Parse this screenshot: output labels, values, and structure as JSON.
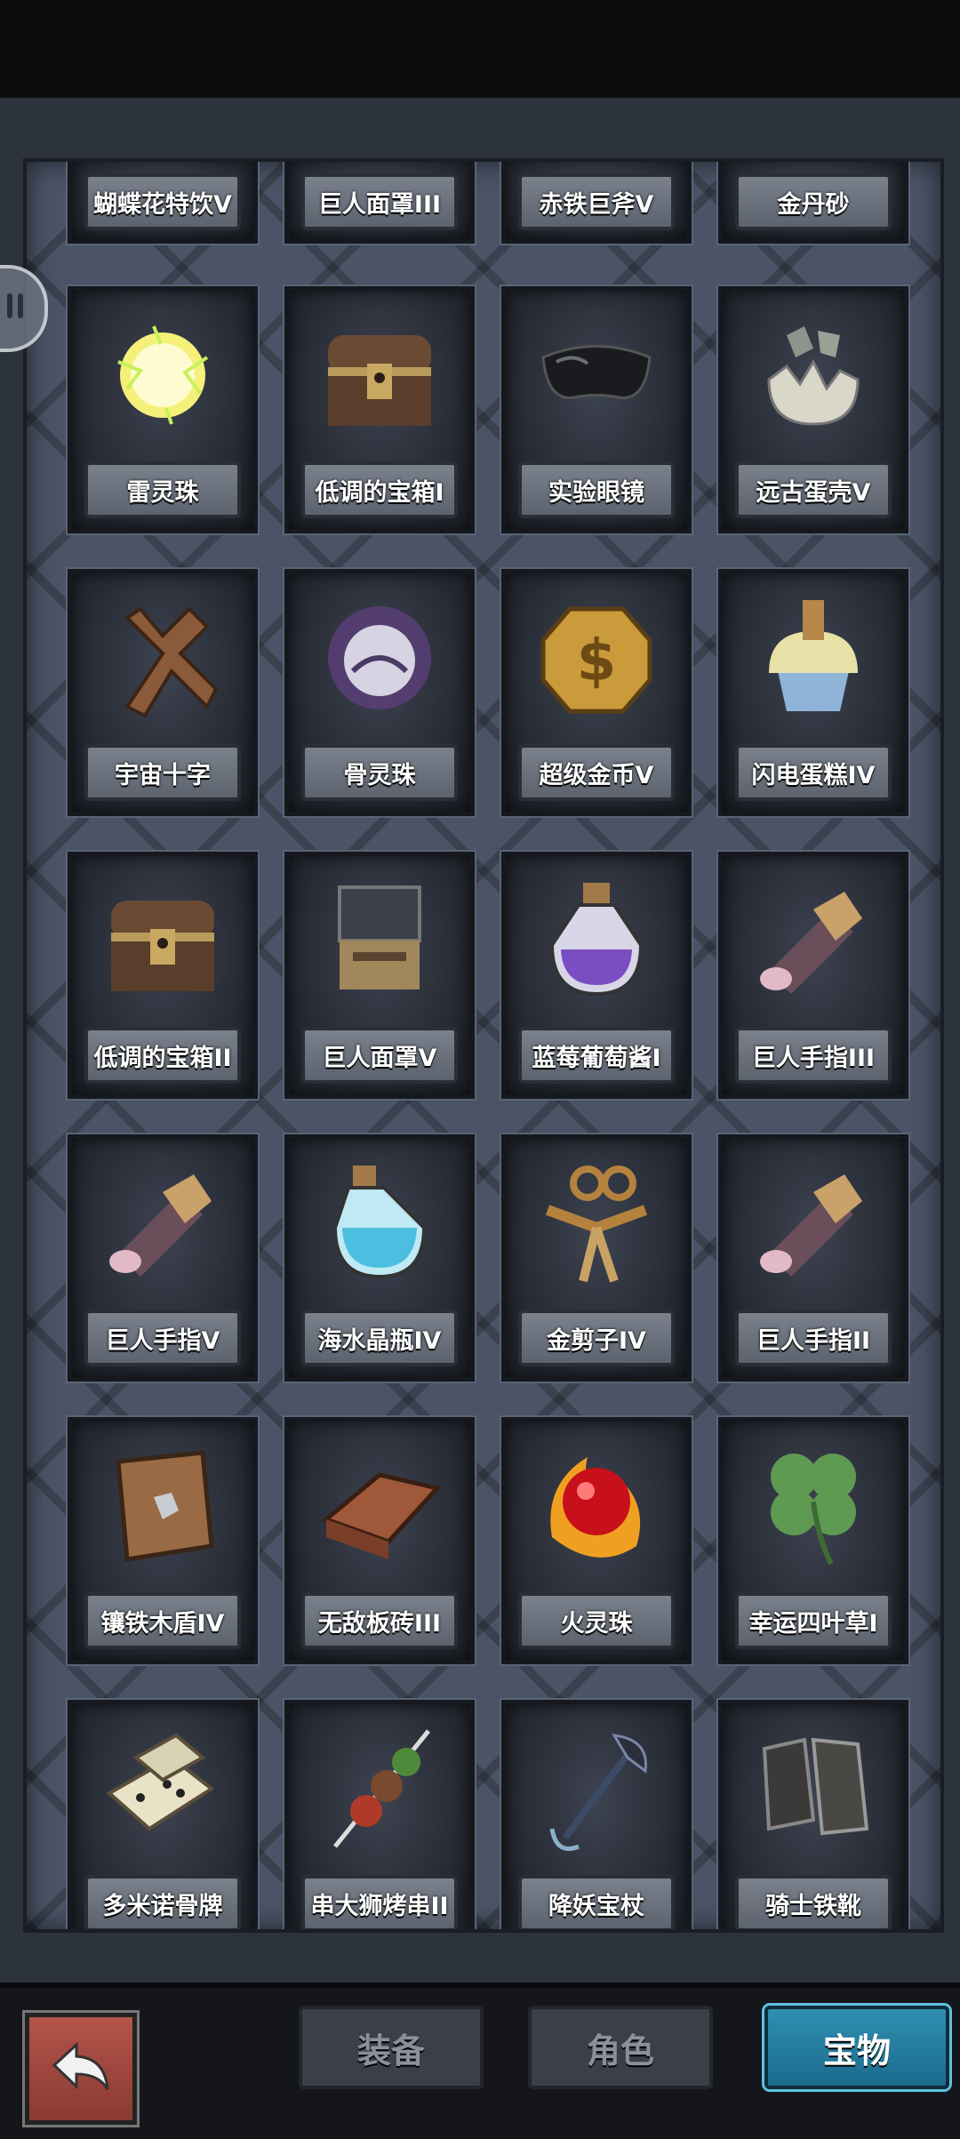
{
  "items": [
    {
      "label": "蝴蝶花特饮V",
      "icon": "drink-icon"
    },
    {
      "label": "巨人面罩III",
      "icon": "mask-icon"
    },
    {
      "label": "赤铁巨斧V",
      "icon": "axe-icon"
    },
    {
      "label": "金丹砂",
      "icon": "sand-icon"
    },
    {
      "label": "雷灵珠",
      "icon": "thunder-orb-icon"
    },
    {
      "label": "低调的宝箱I",
      "icon": "chest-icon"
    },
    {
      "label": "实验眼镜",
      "icon": "goggles-icon"
    },
    {
      "label": "远古蛋壳V",
      "icon": "eggshell-icon"
    },
    {
      "label": "宇宙十字",
      "icon": "cross-icon"
    },
    {
      "label": "骨灵珠",
      "icon": "bone-orb-icon"
    },
    {
      "label": "超级金币V",
      "icon": "gold-coin-icon"
    },
    {
      "label": "闪电蛋糕IV",
      "icon": "cupcake-icon"
    },
    {
      "label": "低调的宝箱II",
      "icon": "chest-icon"
    },
    {
      "label": "巨人面罩V",
      "icon": "mask-icon"
    },
    {
      "label": "蓝莓葡萄酱I",
      "icon": "potion-purple-icon"
    },
    {
      "label": "巨人手指III",
      "icon": "finger-icon"
    },
    {
      "label": "巨人手指V",
      "icon": "finger-icon"
    },
    {
      "label": "海水晶瓶IV",
      "icon": "potion-blue-icon"
    },
    {
      "label": "金剪子IV",
      "icon": "scissors-icon"
    },
    {
      "label": "巨人手指II",
      "icon": "finger-icon"
    },
    {
      "label": "镶铁木盾IV",
      "icon": "wood-shield-icon"
    },
    {
      "label": "无敌板砖III",
      "icon": "brick-icon"
    },
    {
      "label": "火灵珠",
      "icon": "fire-orb-icon"
    },
    {
      "label": "幸运四叶草I",
      "icon": "clover-icon"
    },
    {
      "label": "多米诺骨牌",
      "icon": "domino-icon"
    },
    {
      "label": "串大狮烤串II",
      "icon": "skewer-icon"
    },
    {
      "label": "降妖宝杖",
      "icon": "staff-icon"
    },
    {
      "label": "骑士铁靴",
      "icon": "boots-icon"
    }
  ],
  "tabs": [
    {
      "label": "装备",
      "active": false
    },
    {
      "label": "角色",
      "active": false
    },
    {
      "label": "宝物",
      "active": true
    }
  ],
  "colors": {
    "panel": "#4a5466",
    "active_tab": "#2f8fb1",
    "back_button": "#b3544a"
  }
}
